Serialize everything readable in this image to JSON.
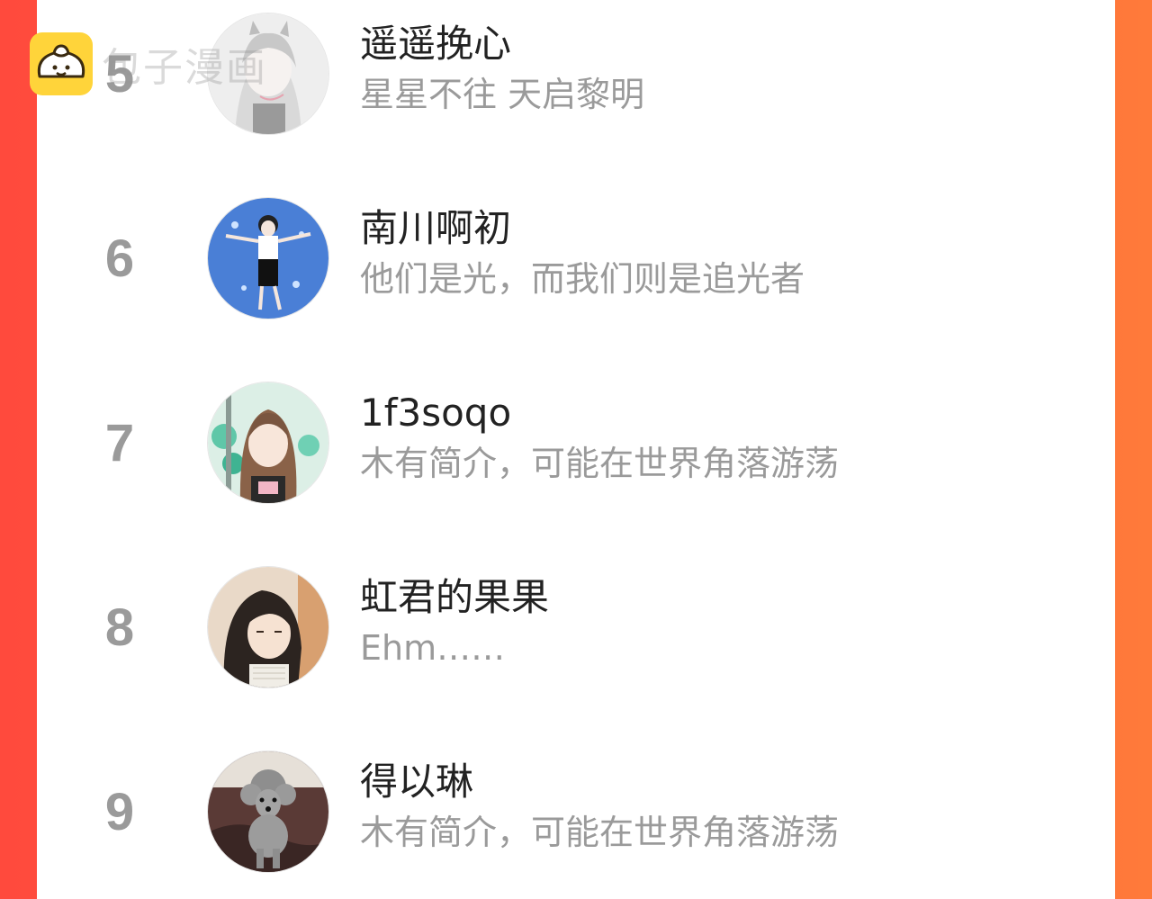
{
  "watermark": {
    "text": "包子漫画",
    "icon": "bun-logo-icon"
  },
  "colors": {
    "background_left": "#ff4a3d",
    "background_right": "#ff7a3a",
    "panel": "#ffffff",
    "name": "#222222",
    "bio": "#9a9a9a",
    "rank": "#9a9a9a",
    "logo": "#ffd43a"
  },
  "list": {
    "items": [
      {
        "rank": "5",
        "name": "遥遥挽心",
        "bio": "星星不往 天启黎明",
        "avatar_icon": "avatar-anime-girl-icon"
      },
      {
        "rank": "6",
        "name": "南川啊初",
        "bio": "他们是光，而我们则是追光者",
        "avatar_icon": "avatar-boy-blue-icon"
      },
      {
        "rank": "7",
        "name": "1f3soqo",
        "bio": "木有简介，可能在世界角落游荡",
        "avatar_icon": "avatar-girl-flowers-icon"
      },
      {
        "rank": "8",
        "name": "虹君的果果",
        "bio": "Ehm……",
        "avatar_icon": "avatar-man-longhair-icon"
      },
      {
        "rank": "9",
        "name": "得以琳",
        "bio": "木有简介，可能在世界角落游荡",
        "avatar_icon": "avatar-poodle-icon"
      }
    ]
  }
}
